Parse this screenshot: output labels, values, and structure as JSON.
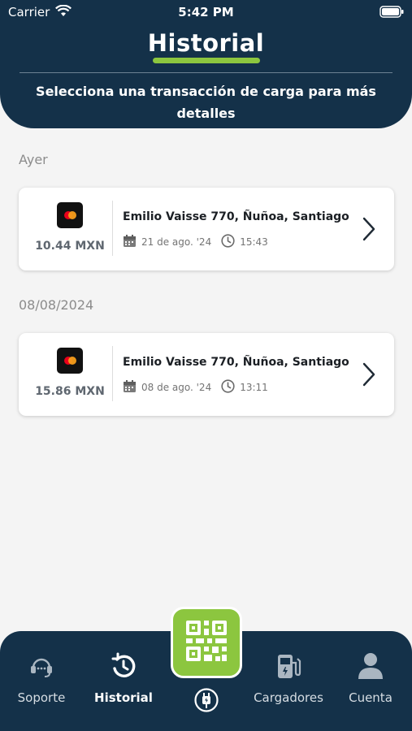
{
  "status_bar": {
    "carrier": "Carrier",
    "time": "5:42 PM"
  },
  "header": {
    "title": "Historial",
    "subtitle": "Selecciona una transacción de carga para más detalles"
  },
  "transactions": [
    {
      "group": "Ayer",
      "amount": "10.44 MXN",
      "address": "Emilio Vaisse 770, Ñuñoa, Santiago",
      "date": "21 de ago. '24",
      "time": "15:43",
      "payment_icon": "mastercard-icon"
    },
    {
      "group": "08/08/2024",
      "amount": "15.86 MXN",
      "address": "Emilio Vaisse 770, Ñuñoa, Santiago",
      "date": "08 de ago. '24",
      "time": "13:11",
      "payment_icon": "mastercard-icon"
    }
  ],
  "tab_bar": {
    "items": [
      {
        "label": "Soporte",
        "icon": "support-icon"
      },
      {
        "label": "Historial",
        "icon": "history-icon",
        "active": true
      },
      {
        "label": "Cargadores",
        "icon": "charger-station-icon"
      },
      {
        "label": "Cuenta",
        "icon": "account-icon"
      }
    ],
    "center_button_icon": "qr-code-icon"
  },
  "colors": {
    "navy": "#143149",
    "accent_green": "#8cc63f",
    "background": "#f4f4f4"
  }
}
